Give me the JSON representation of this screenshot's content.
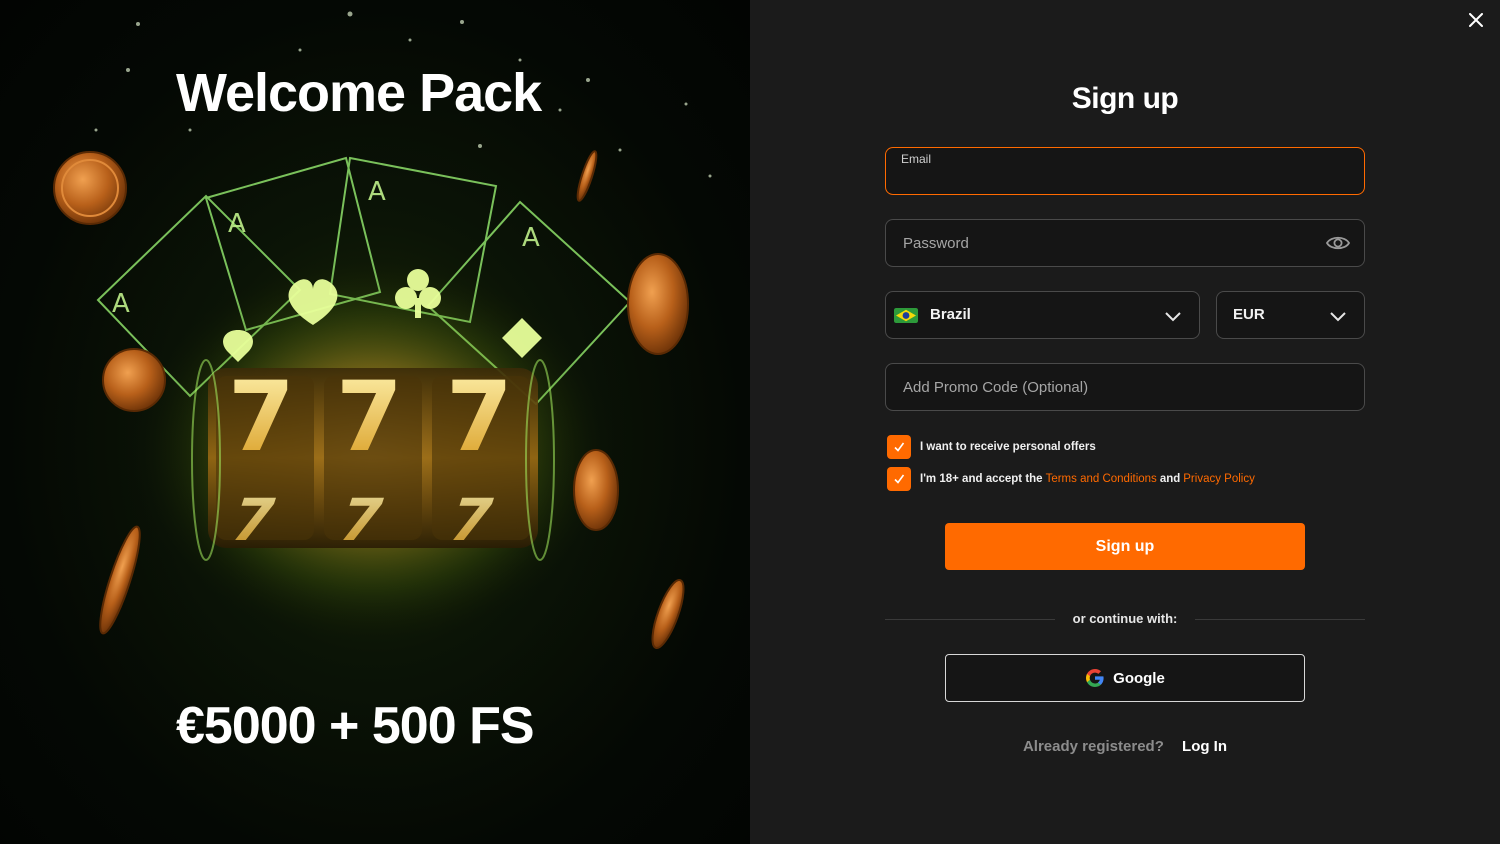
{
  "promo": {
    "title": "Welcome Pack",
    "offer": "€5000 + 500 FS"
  },
  "form": {
    "title": "Sign up",
    "email": {
      "label": "Email",
      "value": ""
    },
    "password": {
      "placeholder": "Password",
      "value": ""
    },
    "country": {
      "value": "Brazil",
      "flag": "brazil-flag-icon"
    },
    "currency": {
      "value": "EUR"
    },
    "promo_code": {
      "placeholder": "Add Promo Code (Optional)",
      "value": ""
    },
    "offers_checkbox": {
      "checked": true,
      "label": "I want to receive personal offers"
    },
    "terms_checkbox": {
      "checked": true,
      "prefix": "I'm 18+ and accept the",
      "terms_link": "Terms and Conditions",
      "joiner": "and",
      "privacy_link": "Privacy Policy"
    },
    "submit_label": "Sign up",
    "divider_text": "or continue with:",
    "google_label": "Google",
    "login_prompt": "Already registered?",
    "login_link": "Log In"
  },
  "colors": {
    "accent": "#ff6a00",
    "background": "#1b1b1b",
    "promo_bg": "#040804",
    "glow": "#b8ff3a",
    "coin": "#c8731f"
  },
  "icons": [
    "close-icon",
    "eye-icon",
    "chevron-down-icon",
    "checkmark-icon",
    "google-icon",
    "brazil-flag-icon"
  ]
}
